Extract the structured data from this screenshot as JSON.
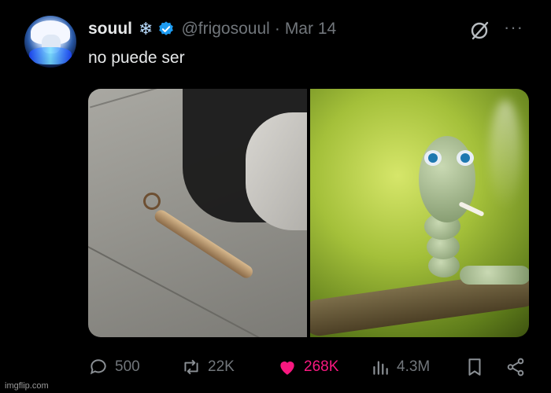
{
  "tweet": {
    "author_name": "souul",
    "name_emoji": "❄",
    "handle": "@frigosouul",
    "separator": "·",
    "date": "Mar 14",
    "text": "no puede ser",
    "more_label": "···"
  },
  "actions": {
    "replies": "500",
    "reposts": "22K",
    "likes": "268K",
    "views": "4.3M"
  },
  "colors": {
    "like_active": "#f91880",
    "verified": "#1d9bf0",
    "muted": "#71767b"
  },
  "watermark": "imgflip.com"
}
